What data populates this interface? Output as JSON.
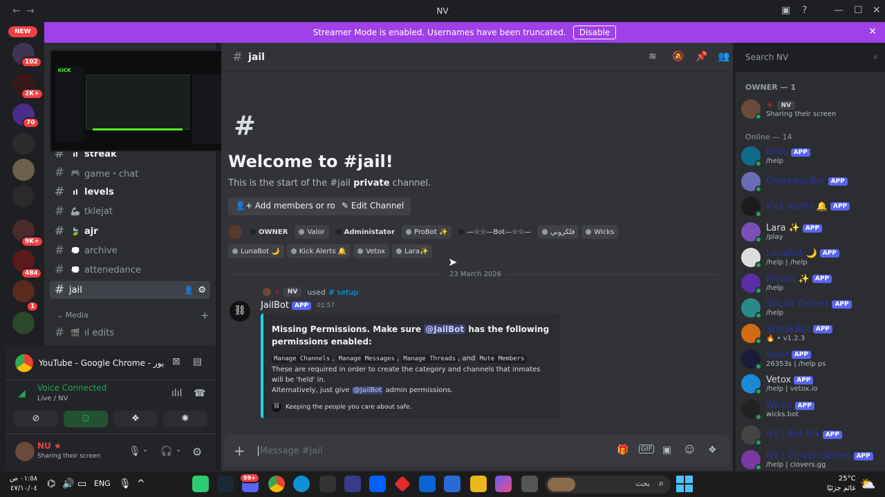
{
  "window": {
    "title": "NV"
  },
  "banner": {
    "text": "Streamer Mode is enabled. Usernames have been truncated.",
    "button": "Disable"
  },
  "servers": {
    "new_label": "NEW",
    "badges": [
      "102",
      "2K+",
      "70",
      "9K+",
      "484",
      "1"
    ]
  },
  "channels": [
    {
      "name": "streak",
      "emoji": "ıl",
      "bold": true
    },
    {
      "name": "game・chat",
      "emoji": "🎮",
      "bold": false
    },
    {
      "name": "levels",
      "emoji": "ıl",
      "bold": true
    },
    {
      "name": "tklejat",
      "emoji": "🦾",
      "bold": false
    },
    {
      "name": "ajr",
      "emoji": "🍃",
      "bold": true
    },
    {
      "name": "archive",
      "emoji": "💭",
      "bold": false
    },
    {
      "name": "attenedance",
      "emoji": "💭",
      "bold": false
    },
    {
      "name": "jail",
      "emoji": "",
      "bold": false
    }
  ],
  "category": {
    "name": "Media"
  },
  "media_channel": {
    "name": "ıl edits"
  },
  "stream_card": {
    "title": "YouTube - Google Chrome - يور"
  },
  "voice": {
    "status": "Voice Connected",
    "sub": "Live / NV"
  },
  "user": {
    "name": "NU",
    "status": "Sharing their screen"
  },
  "header": {
    "channel": "jail",
    "search_placeholder": "Search NV"
  },
  "welcome": {
    "title": "Welcome to #jail!",
    "desc_prefix": "This is the start of the #jail",
    "desc_bold": "private",
    "desc_suffix": "channel.",
    "add_members": "Add members or roles",
    "edit_channel": "Edit Channel"
  },
  "roles": [
    {
      "label": "OWNER",
      "color": "#1e1f22"
    },
    {
      "label": "Valor",
      "color": "#949ba4"
    },
    {
      "label": "Administator",
      "color": "#1e1f22"
    },
    {
      "label": "ProBot ✨",
      "color": "#949ba4"
    },
    {
      "label": "—☆☆—Bot—☆☆—",
      "color": "#1e1f22"
    },
    {
      "label": "فلكروني",
      "color": "#949ba4"
    },
    {
      "label": "Wicks",
      "color": "#949ba4"
    },
    {
      "label": "LunaBot 🌙",
      "color": "#949ba4"
    },
    {
      "label": "Kick Alerts 🔔",
      "color": "#949ba4"
    },
    {
      "label": "Vetox",
      "color": "#949ba4"
    },
    {
      "label": "Lara✨",
      "color": "#949ba4"
    }
  ],
  "divider_date": "23 March 2026",
  "message": {
    "reply_user": "NV",
    "reply_used": "used",
    "reply_cmd": "# setup",
    "author": "JailBot",
    "app": "APP",
    "time": "01:57",
    "embed_title_1": "Missing Permissions. Make sure",
    "embed_mention": "@JailBot",
    "embed_title_2": "has the following permissions enabled:",
    "perms": [
      "Manage Channels",
      "Manage Messages",
      "Manage Threads",
      "Mute Members"
    ],
    "and": ", and",
    "line2": "These are required in order to create the category and channels that inmates will be 'held' in.",
    "line3_prefix": "Alternatively, just give",
    "line3_suffix": "admin permissions.",
    "footer": "Keeping the people you care about safe."
  },
  "input": {
    "placeholder": "Message #jail"
  },
  "members": {
    "owner_header": "OWNER — 1",
    "owner": {
      "name": "NV",
      "status": "Sharing their screen"
    },
    "online_header": "Online — 14",
    "list": [
      {
        "name": "Firbo",
        "sub": "/help",
        "color": "#0f6b8c"
      },
      {
        "name": "GiveawayBot",
        "sub": "",
        "color": "#6b6bb8"
      },
      {
        "name": "Kick Alerts 🔔",
        "sub": "",
        "color": "#1b1b1b"
      },
      {
        "name": "Lara ✨",
        "sub": "/play",
        "color": "#7b4fb8",
        "light": true
      },
      {
        "name": "LunaBot 🌙",
        "sub": "/help | /help",
        "color": "#ddd"
      },
      {
        "name": "ProBot ✨",
        "sub": "/help",
        "color": "#5a2ea6"
      },
      {
        "name": "SOLAY Games",
        "sub": "/help",
        "color": "#2a8a8a"
      },
      {
        "name": "StreakBot",
        "sub": "🔥 • v1.2.3",
        "color": "#d46a12"
      },
      {
        "name": "Valor",
        "sub": "26353s | /help ps",
        "color": "#1b1b3a"
      },
      {
        "name": "Vetox",
        "sub": "/help | vetox.io",
        "color": "#1a8ad6",
        "light": true
      },
      {
        "name": "Wicks",
        "sub": "wicks.bot",
        "color": "#222"
      },
      {
        "name": "NV | Bot Rix",
        "sub": "",
        "color": "#444"
      },
      {
        "name": "NV | Clover Games",
        "sub": "/help | clovers.gg",
        "color": "#7a3aa6"
      }
    ],
    "app": "APP"
  },
  "taskbar": {
    "time": "٠١:٥٨ ص",
    "date": "٤٧/١٠/٠٤",
    "lang": "ENG",
    "search_placeholder": "بحث",
    "weather_temp": "25°C",
    "weather_desc": "غائم جزئيًا",
    "discord_badge": "99+"
  }
}
